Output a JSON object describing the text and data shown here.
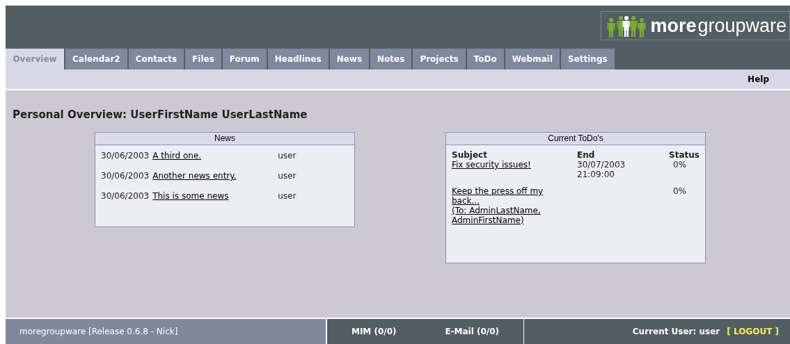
{
  "logo": {
    "bold": "more",
    "light": "groupware"
  },
  "tabs": [
    {
      "label": "Overview",
      "selected": true
    },
    {
      "label": "Calendar2",
      "selected": false
    },
    {
      "label": "Contacts",
      "selected": false
    },
    {
      "label": "Files",
      "selected": false
    },
    {
      "label": "Forum",
      "selected": false
    },
    {
      "label": "Headlines",
      "selected": false
    },
    {
      "label": "News",
      "selected": false
    },
    {
      "label": "Notes",
      "selected": false
    },
    {
      "label": "Projects",
      "selected": false
    },
    {
      "label": "ToDo",
      "selected": false
    },
    {
      "label": "Webmail",
      "selected": false
    },
    {
      "label": "Settings",
      "selected": false
    }
  ],
  "help": "Help",
  "heading": "Personal Overview: UserFirstName UserLastName",
  "news": {
    "title": "News",
    "rows": [
      {
        "date": "30/06/2003",
        "title": "A third one.",
        "author": "user"
      },
      {
        "date": "30/06/2003",
        "title": "Another news entry.",
        "author": "user"
      },
      {
        "date": "30/06/2003",
        "title": "This is some news",
        "author": "user"
      }
    ]
  },
  "todos": {
    "title": "Current ToDo's",
    "columns": [
      "Subject",
      "End",
      "Status"
    ],
    "rows": [
      {
        "subject": "Fix security issues!",
        "end": [
          "30/07/2003",
          "21:09:00"
        ],
        "status": "0%"
      },
      {
        "subject": "Keep the press off my back...",
        "note": "(To: AdminLastName, AdminFirstName)",
        "end": [],
        "status": "0%"
      }
    ]
  },
  "status_bar": {
    "version": "moregroupware [Release 0.6.8 - Nick]",
    "mim": "MIM (0/0)",
    "email": "E-Mail (0/0)",
    "user": "Current User: user",
    "logout": "[ LOGOUT ]"
  }
}
